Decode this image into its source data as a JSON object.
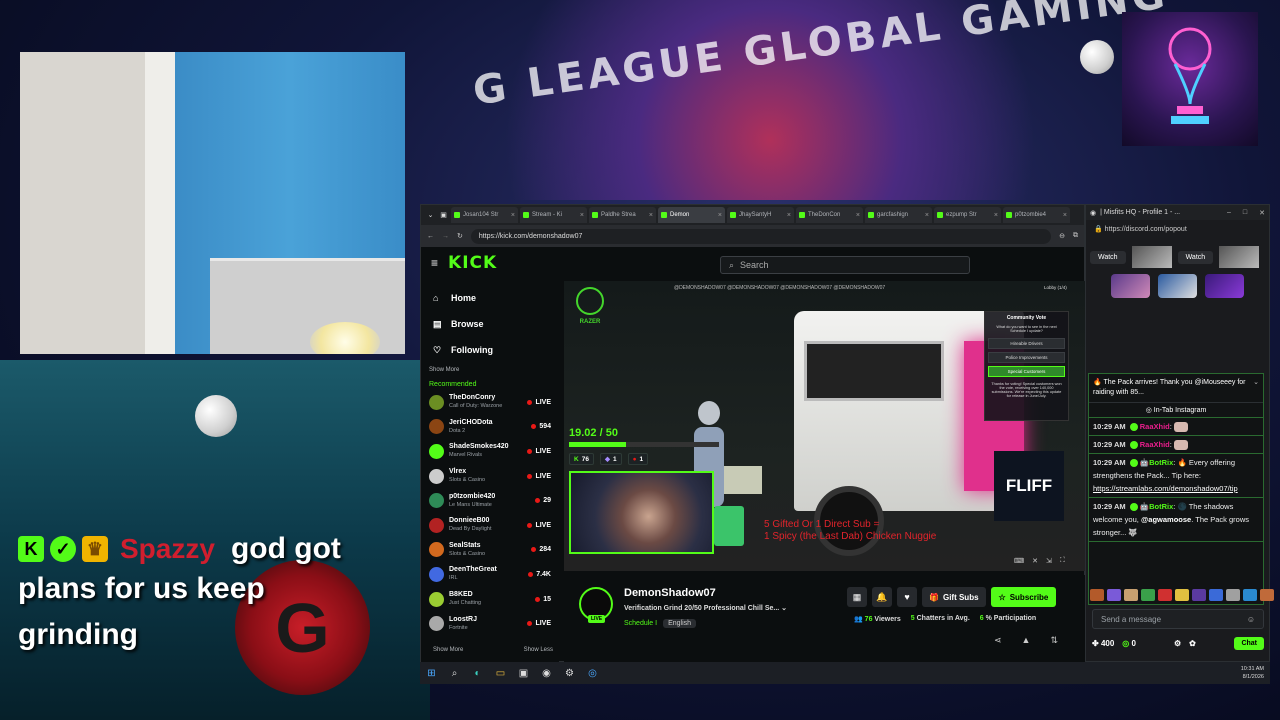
{
  "background": {
    "title": "G LEAGUE GLOBAL GAMING"
  },
  "overlay_chat": {
    "username": "Spazzy",
    "message_first": "god got",
    "message_line2": "plans for us keep",
    "message_line3": "grinding",
    "badge_k": "K",
    "logo_letter": "G"
  },
  "browser": {
    "tabs": [
      {
        "label": "Josan104 Str",
        "active": false
      },
      {
        "label": "Stream - Ki",
        "active": false
      },
      {
        "label": "Paldhe Strea",
        "active": false
      },
      {
        "label": "Demon",
        "active": true
      },
      {
        "label": "JhaySantyH",
        "active": false
      },
      {
        "label": "TheDonCon",
        "active": false
      },
      {
        "label": "garcfashign",
        "active": false
      },
      {
        "label": "ezpump Str",
        "active": false
      },
      {
        "label": "p0tzombie4",
        "active": false
      }
    ],
    "url": "https://kick.com/demonshadow07"
  },
  "kick": {
    "logo": "KICK",
    "search_placeholder": "Search",
    "nav": {
      "home": "Home",
      "browse": "Browse",
      "following": "Following"
    },
    "show_more": "Show More",
    "recommended_label": "Recommended",
    "recommended": [
      {
        "name": "TheDonConry",
        "game": "Call of Duty: Warzone",
        "count": "LIVE",
        "color": "#6b8e23"
      },
      {
        "name": "JeriCHODota",
        "game": "Dota 2",
        "count": "594",
        "color": "#8b4513"
      },
      {
        "name": "ShadeSmokes420",
        "game": "Marvel Rivals",
        "count": "LIVE",
        "color": "#53fc18"
      },
      {
        "name": "Vlrex",
        "game": "Slots & Casino",
        "count": "LIVE",
        "color": "#cccccc"
      },
      {
        "name": "p0tzombie420",
        "game": "Le Mans Ultimate",
        "count": "29",
        "color": "#2e8b57"
      },
      {
        "name": "DonnieeB00",
        "game": "Dead By Daylight",
        "count": "LIVE",
        "color": "#b22222"
      },
      {
        "name": "SealStats",
        "game": "Slots & Casino",
        "count": "284",
        "color": "#d2691e"
      },
      {
        "name": "DeenTheGreat",
        "game": "IRL",
        "count": "7.4K",
        "color": "#4169e1"
      },
      {
        "name": "B8KED",
        "game": "Just Chatting",
        "count": "15",
        "color": "#9acd32"
      },
      {
        "name": "LoostRJ",
        "game": "Fortnite",
        "count": "LIVE",
        "color": "#a9a9a9"
      }
    ],
    "footer": {
      "show_more": "Show More",
      "show_less": "Show Less"
    }
  },
  "video": {
    "watermarks": "@DEMONSHADOW07  @DEMONSHADOW07  @DEMONSHADOW07  @DEMONSHADOW07",
    "razer": "RAZER",
    "goal_text": "19.02 / 50",
    "goal_progress": 0.38,
    "stat_a": "76",
    "stat_b": "1",
    "stat_c": "1",
    "red_line1": "5 Gifted Or 1 Direct Sub =",
    "red_line2": "1 Spicy (the Last Dab) Chicken Nuggie",
    "fliff": "FLIFF",
    "lobby": "Lobby (1/4)",
    "vote": {
      "title": "Community Vote",
      "sub": "What do you want to see in the next Schedule I update?",
      "options": [
        "Hireable Drivers",
        "Police Improvements",
        "Special Customers"
      ],
      "selected": 2,
      "footer": "Thanks for voting! Special customers won the vote, receiving over 140,000 submissions. We're expecting this update for release in June/July."
    }
  },
  "stream_info": {
    "channel": "DemonShadow07",
    "title": "Verification Grind 20/50 Professional Chill Se...",
    "category": "Schedule I",
    "language": "English",
    "live_badge": "LIVE",
    "gift_subs": "Gift Subs",
    "subscribe": "Subscribe",
    "viewers_num": "76",
    "viewers_label": "Viewers",
    "chatters_num": "5",
    "chatters_label": "Chatters in Avg.",
    "participation_num": "6",
    "participation_label": "% Participation"
  },
  "discord": {
    "title": "| Misfits HQ - Profile 1 - ...",
    "url": "https://discord.com/popout",
    "watch": "Watch",
    "pinned": "🔥 The Pack arrives! Thank you @iMouseeey for raiding with 85...",
    "in_tab": "In-Tab Instagram",
    "messages": [
      {
        "time": "10:29 AM",
        "user": "RaaXhid",
        "type": "emote",
        "text": ""
      },
      {
        "time": "10:29 AM",
        "user": "RaaXhid",
        "type": "emote",
        "text": ""
      },
      {
        "time": "10:29 AM",
        "user": "BotRix",
        "type": "bot",
        "text": "🔥 Every offering strengthens the Pack... Tip here:",
        "link": "https://streamlabs.com/demonshadow07/tip"
      },
      {
        "time": "10:29 AM",
        "user": "BotRix",
        "type": "bot",
        "text": "🌑 The shadows welcome you,",
        "mention": "@agwamoose",
        "after": ". The Pack grows stronger... 🐺"
      }
    ],
    "input_placeholder": "Send a message",
    "points": "400",
    "zero": "0",
    "chat_button": "Chat"
  },
  "taskbar": {
    "time": "10:31 AM",
    "date": "8/1/2026"
  }
}
